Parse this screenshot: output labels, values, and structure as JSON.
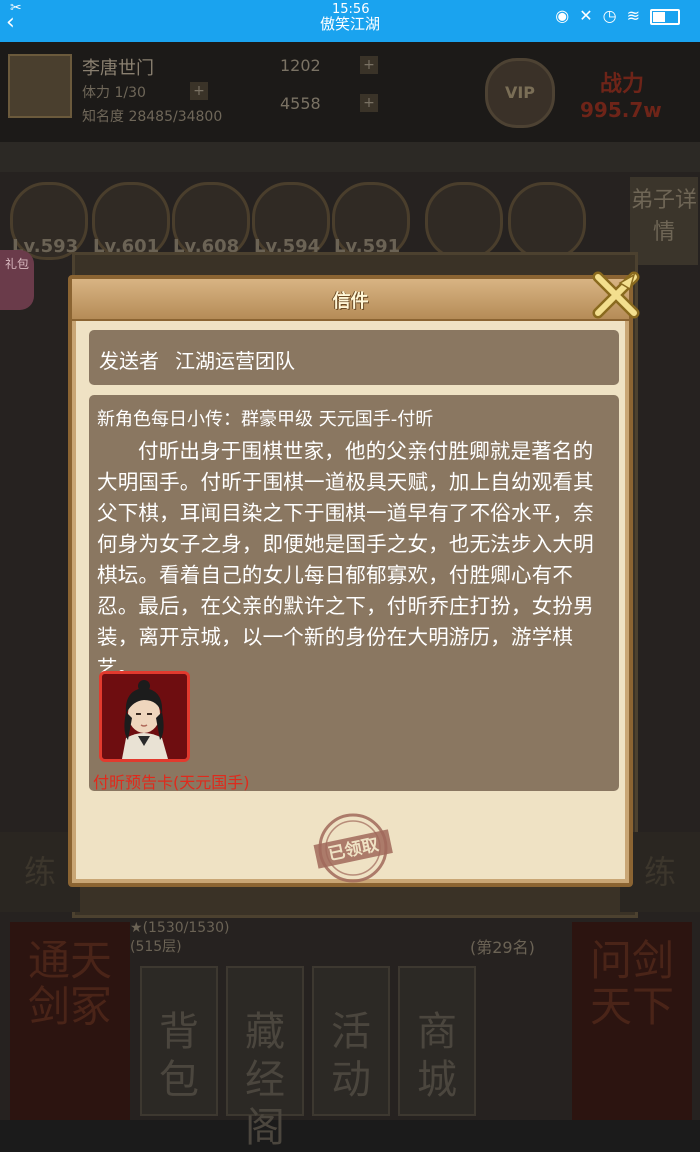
{
  "status_bar": {
    "time": "15:56",
    "app_title": "傲笑江湖"
  },
  "player": {
    "name": "李唐世门",
    "stamina": "体力 1/30",
    "fame": "知名度 28485/34800",
    "silver": "1202",
    "gold": "4558",
    "vip": "VIP",
    "power_label": "战力",
    "power_value": "995.7w"
  },
  "heroes": [
    {
      "level": "Lv.593"
    },
    {
      "level": "Lv.601"
    },
    {
      "level": "Lv.608"
    },
    {
      "level": "Lv.594"
    },
    {
      "level": "Lv.591"
    }
  ],
  "detail_button": "弟子详情",
  "gift_tag": "礼包",
  "side_train_label": "练",
  "bottom": {
    "stars_progress": "(1530/1530)",
    "floors": "(515层)",
    "rank": "(第29名)",
    "left_pillar": "通天剑冢",
    "right_pillar": "问剑天下",
    "nav": [
      "背包",
      "藏经阁",
      "活动",
      "商城"
    ]
  },
  "dialog": {
    "title": "信件",
    "sender_label": "发送者",
    "sender_value": "江湖运营团队",
    "subject": "新角色每日小传：群豪甲级 天元国手-付昕",
    "body": "付昕出身于围棋世家，他的父亲付胜卿就是著名的大明国手。付昕于围棋一道极具天赋，加上自幼观看其父下棋，耳闻目染之下于围棋一道早有了不俗水平，奈何身为女子之身，即便她是国手之女，也无法步入大明棋坛。看着自己的女儿每日郁郁寡欢，付胜卿心有不忍。最后，在父亲的默许之下，付昕乔庄打扮，女扮男装，离开京城，以一个新的身份在大明游历，游学棋艺。",
    "attachment_name": "付昕预告卡(天元国手)",
    "claimed_label": "已领取"
  },
  "colors": {
    "status_bar": "#1aa3ef",
    "dialog_frame": "#8b6432",
    "text_box": "#8a7761",
    "item_red": "#e02a1c"
  }
}
